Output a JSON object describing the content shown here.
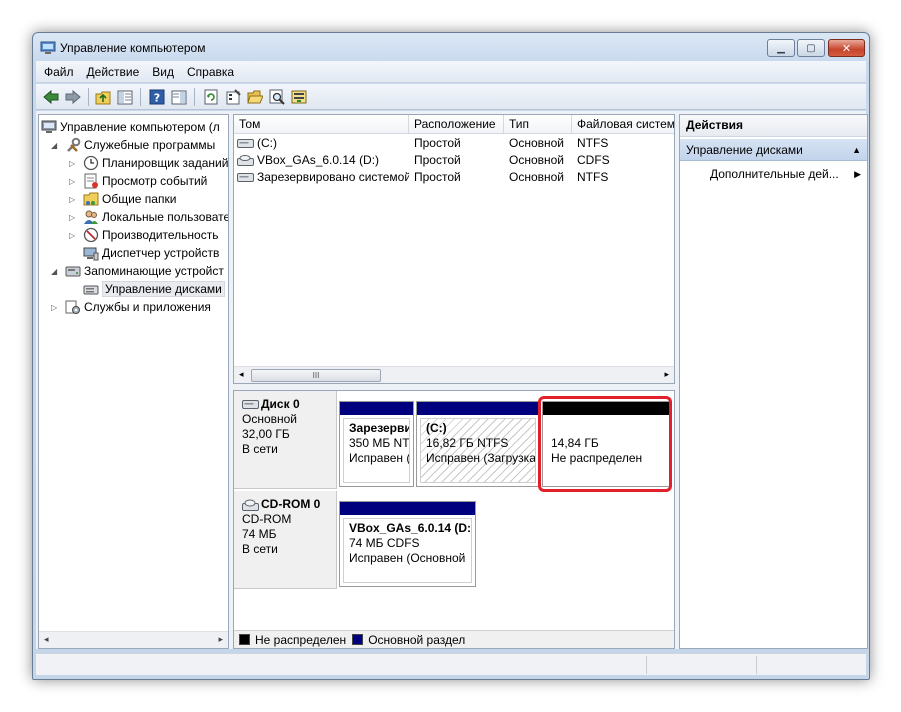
{
  "window": {
    "title": "Управление компьютером",
    "controls": {
      "minimize": "▁",
      "maximize": "▢",
      "close": "✕"
    }
  },
  "menu": [
    "Файл",
    "Действие",
    "Вид",
    "Справка"
  ],
  "toolbar": {
    "icons": [
      "back-arrow-icon",
      "forward-arrow-icon",
      "up-folder-icon",
      "show-tree-icon",
      "help-icon",
      "action-pane-icon",
      "refresh-icon",
      "properties-icon",
      "open-folder-icon",
      "search-icon",
      "export-icon"
    ]
  },
  "tree": {
    "items": [
      {
        "label": "Управление компьютером (л",
        "level": 0,
        "arrow": ""
      },
      {
        "label": "Служебные программы",
        "level": 1,
        "arrow": "◢"
      },
      {
        "label": "Планировщик заданий",
        "level": 2,
        "arrow": "▷"
      },
      {
        "label": "Просмотр событий",
        "level": 2,
        "arrow": "▷"
      },
      {
        "label": "Общие папки",
        "level": 2,
        "arrow": "▷"
      },
      {
        "label": "Локальные пользовате",
        "level": 2,
        "arrow": "▷"
      },
      {
        "label": "Производительность",
        "level": 2,
        "arrow": "▷"
      },
      {
        "label": "Диспетчер устройств",
        "level": 2,
        "arrow": ""
      },
      {
        "label": "Запоминающие устройст",
        "level": 1,
        "arrow": "◢"
      },
      {
        "label": "Управление дисками",
        "level": 2,
        "arrow": ""
      },
      {
        "label": "Службы и приложения",
        "level": 1,
        "arrow": "▷"
      }
    ],
    "scroll_left": "◂",
    "scroll_right": "▸"
  },
  "volumes": {
    "columns": [
      "Том",
      "Расположение",
      "Тип",
      "Файловая систем"
    ],
    "rows": [
      {
        "name": "(C:)",
        "layout": "Простой",
        "type": "Основной",
        "fs": "NTFS"
      },
      {
        "name": "VBox_GAs_6.0.14 (D:)",
        "layout": "Простой",
        "type": "Основной",
        "fs": "CDFS"
      },
      {
        "name": "Зарезервировано системой",
        "layout": "Простой",
        "type": "Основной",
        "fs": "NTFS"
      }
    ],
    "scroll_thumb": "III",
    "scroll_left": "◂",
    "scroll_right": "▸"
  },
  "disks": [
    {
      "name": "Диск 0",
      "kind": "Основной",
      "size": "32,00 ГБ",
      "status": "В сети",
      "partitions": [
        {
          "title": "Зарезерви",
          "size": "350 МБ NTF",
          "status": "Исправен (",
          "bar_color": "#00007f"
        },
        {
          "title": "(C:)",
          "size": "16,82 ГБ NTFS",
          "status": "Исправен (Загрузка,",
          "bar_color": "#00007f"
        },
        {
          "title": "",
          "size": "14,84 ГБ",
          "status": "Не распределен",
          "bar_color": "#000000"
        }
      ]
    },
    {
      "name": "CD-ROM 0",
      "kind": "CD-ROM",
      "size": "74 МБ",
      "status": "В сети",
      "partitions": [
        {
          "title": "VBox_GAs_6.0.14  (D:)",
          "size": "74 МБ CDFS",
          "status": "Исправен (Основной",
          "bar_color": "#00007f"
        }
      ]
    }
  ],
  "legend": [
    {
      "label": "Не распределен",
      "color": "#000000"
    },
    {
      "label": "Основной раздел",
      "color": "#00007f"
    }
  ],
  "actions": {
    "title": "Действия",
    "section": "Управление дисками",
    "section_arrow": "▲",
    "item": "Дополнительные дей...",
    "item_arrow": "▶"
  },
  "colors": {
    "highlight": "#e2202b",
    "primary_partition": "#00007f",
    "unallocated": "#000000"
  }
}
